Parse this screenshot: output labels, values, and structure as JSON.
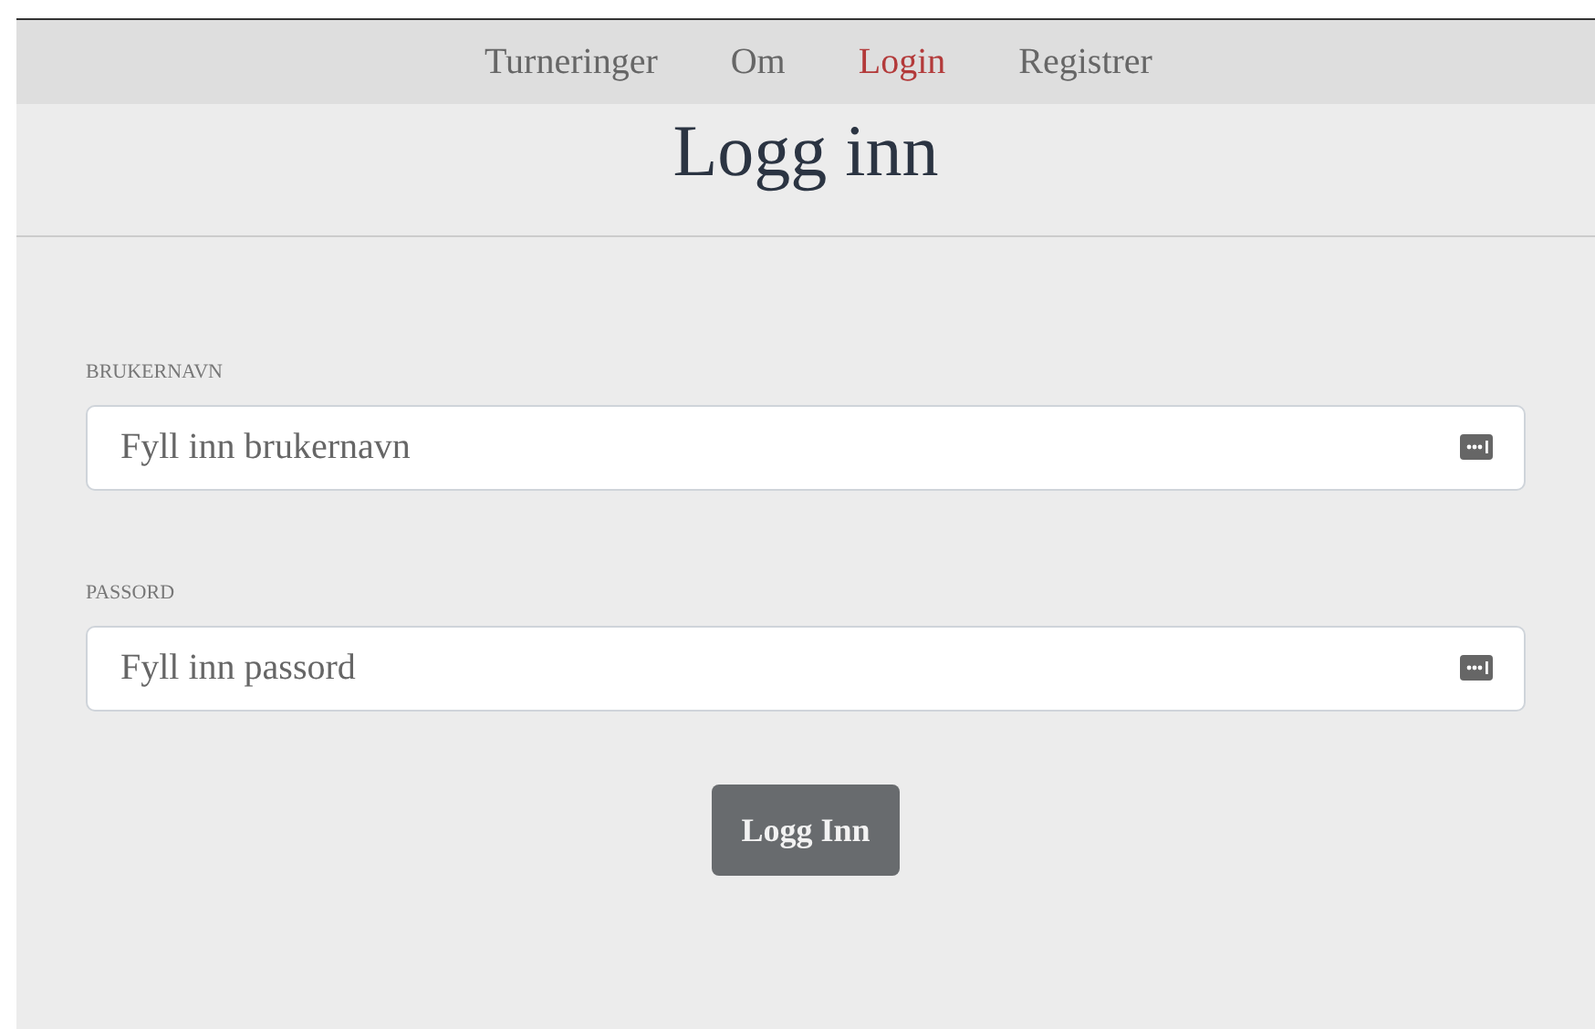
{
  "nav": {
    "items": [
      {
        "label": "Turneringer",
        "selected": false
      },
      {
        "label": "Om",
        "selected": false
      },
      {
        "label": "Login",
        "selected": true
      },
      {
        "label": "Registrer",
        "selected": false
      }
    ]
  },
  "title": "Logg inn",
  "form": {
    "fields": [
      {
        "label": "BRUKERNAVN",
        "placeholder": "Fyll inn brukernavn"
      },
      {
        "label": "PASSORD",
        "placeholder": "Fyll inn passord"
      }
    ],
    "submit": "Logg Inn"
  }
}
